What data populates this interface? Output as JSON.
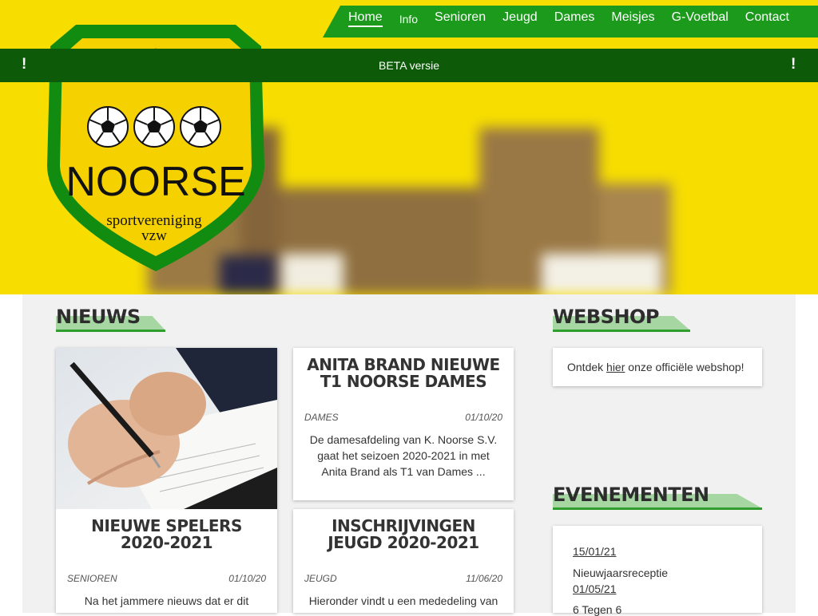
{
  "nav": {
    "items": [
      {
        "label": "Home",
        "active": true
      },
      {
        "label": "Info",
        "active": false
      },
      {
        "label": "Senioren",
        "active": false
      },
      {
        "label": "Jeugd",
        "active": false
      },
      {
        "label": "Dames",
        "active": false
      },
      {
        "label": "Meisjes",
        "active": false
      },
      {
        "label": "G-Voetbal",
        "active": false
      },
      {
        "label": "Contact",
        "active": false
      }
    ]
  },
  "banner": {
    "text": "BETA versie",
    "left_icon": "!",
    "right_icon": "!"
  },
  "logo": {
    "name": "NOORSE",
    "line1": "sportvereniging",
    "line2": "vzw"
  },
  "news": {
    "title": "NIEUWS",
    "articles": [
      {
        "title": "NIEUWE SPELERS 2020-2021",
        "category": "SENIOREN",
        "date": "01/10/20",
        "excerpt": "Na het jammere nieuws dat er dit"
      },
      {
        "title": "ANITA BRAND NIEUWE T1 NOORSE DAMES",
        "category": "DAMES",
        "date": "01/10/20",
        "excerpt": "De damesafdeling van K. Noorse S.V. gaat het seizoen 2020-2021 in met Anita Brand als T1 van Dames ..."
      },
      {
        "title": "INSCHRIJVINGEN JEUGD 2020-2021",
        "category": "JEUGD",
        "date": "11/06/20",
        "excerpt": "Hieronder vindt u een mededeling van"
      }
    ]
  },
  "webshop": {
    "title": "WEBSHOP",
    "text_before": "Ontdek ",
    "link": "hier",
    "text_after": " onze officiële webshop!"
  },
  "events": {
    "title": "EVENEMENTEN",
    "items": [
      {
        "date": "15/01/21",
        "name": "Nieuwjaarsreceptie"
      },
      {
        "date": "01/05/21",
        "name": "6 Tegen 6"
      }
    ]
  },
  "colors": {
    "header_yellow": "#f7de00",
    "nav_green": "#1b9a1b",
    "banner_green": "#0d5a08",
    "accent_light_green": "#a6d6a1"
  }
}
